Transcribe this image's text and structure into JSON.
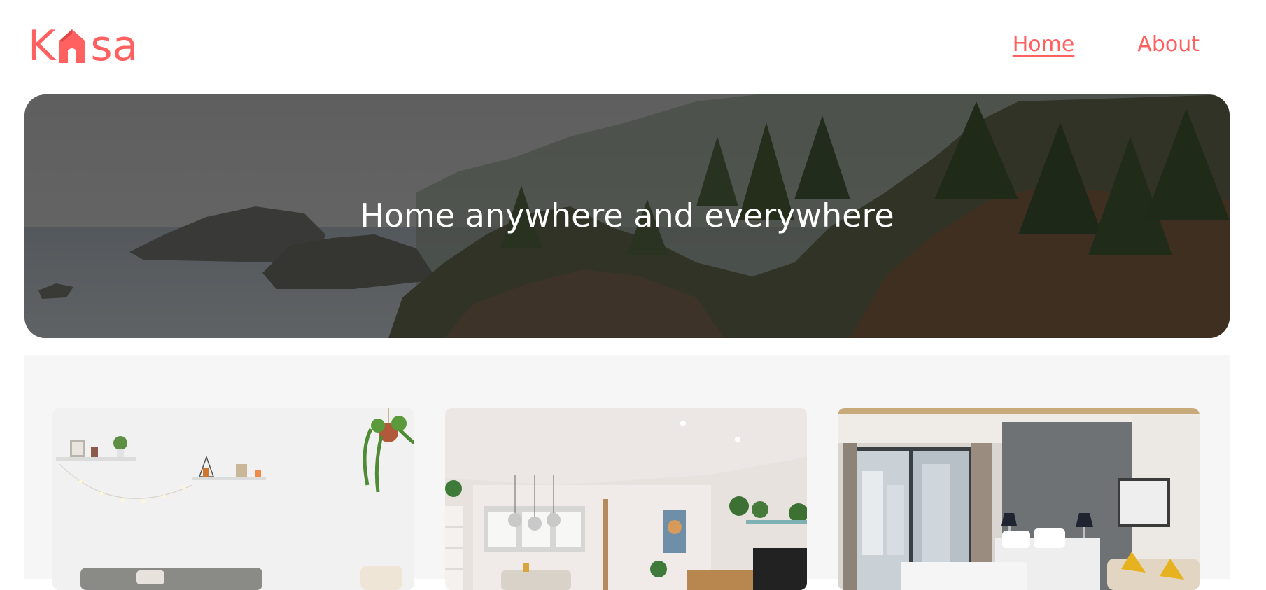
{
  "brand": {
    "logo_prefix": "K",
    "logo_suffix": "sa",
    "logo_text": "Kasa",
    "accent_color": "#FF6060"
  },
  "nav": {
    "items": [
      {
        "label": "Home",
        "active": true
      },
      {
        "label": "About",
        "active": false
      }
    ]
  },
  "banner": {
    "title": "Home anywhere and everywhere"
  },
  "gallery": {
    "background": "#F6F6F6",
    "cards": [
      {
        "title": ""
      },
      {
        "title": ""
      },
      {
        "title": ""
      }
    ]
  }
}
